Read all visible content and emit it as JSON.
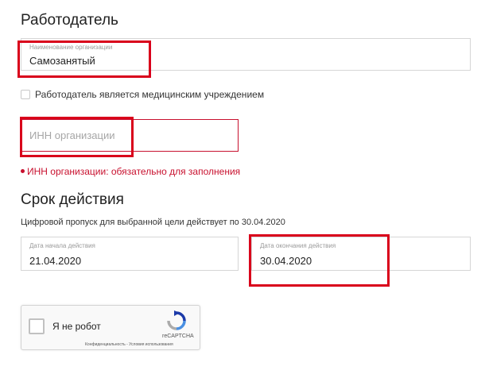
{
  "employer": {
    "heading": "Работодатель",
    "org_name_label": "Наименование организации",
    "org_name_value": "Самозанятый",
    "medical_checkbox_label": "Работодатель является медицинским учреждением",
    "medical_checkbox_checked": false,
    "inn_placeholder": "ИНН организации",
    "inn_error": "ИНН организации: обязательно для заполнения"
  },
  "validity": {
    "heading": "Срок действия",
    "note": "Цифровой пропуск для выбранной цели действует по 30.04.2020",
    "start_label": "Дата начала действия",
    "start_value": "21.04.2020",
    "end_label": "Дата окончания действия",
    "end_value": "30.04.2020"
  },
  "captcha": {
    "label": "Я не робот",
    "brand": "reCAPTCHA",
    "footer": "Конфиденциальность - Условия использования",
    "checked": false
  },
  "colors": {
    "annotation_red": "#d9001b",
    "error_red": "#c8102e",
    "border_gray": "#d6d6d6"
  }
}
